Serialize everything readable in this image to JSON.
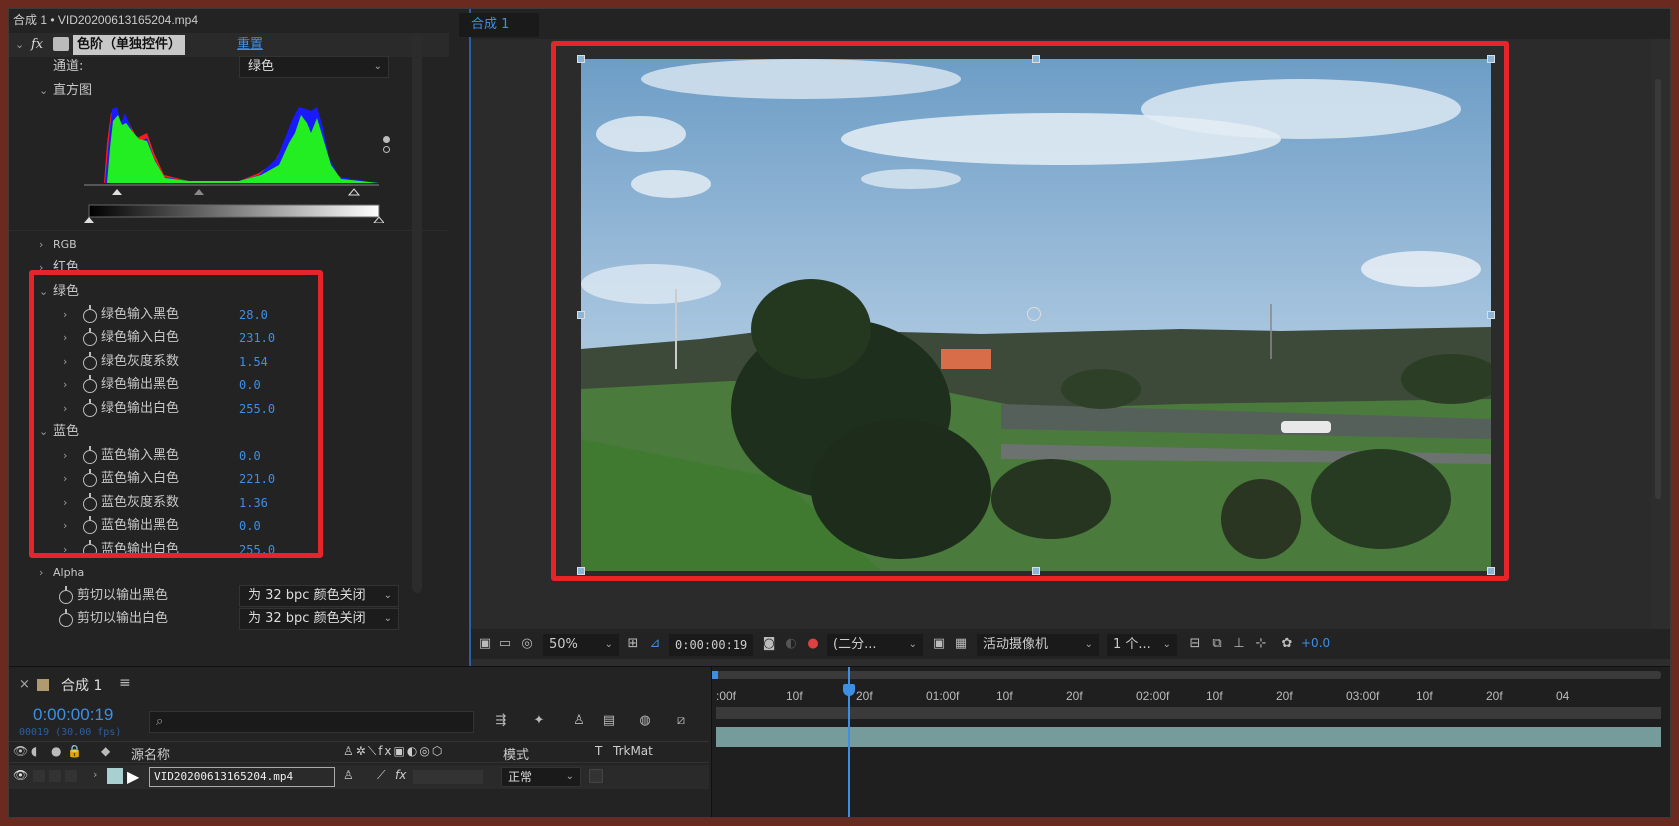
{
  "panel": {
    "title": "合成 1 • VID20200613165204.mp4",
    "effect_name": "色阶（单独控件）",
    "reset": "重置",
    "channel_label": "通道:",
    "channel_value": "绿色",
    "histogram_label": "直方图",
    "sections": {
      "rgb": "RGB",
      "red": "红色",
      "green": "绿色",
      "blue": "蓝色",
      "alpha": "Alpha"
    },
    "green_params": [
      {
        "label": "绿色输入黑色",
        "value": "28.0"
      },
      {
        "label": "绿色输入白色",
        "value": "231.0"
      },
      {
        "label": "绿色灰度系数",
        "value": "1.54"
      },
      {
        "label": "绿色输出黑色",
        "value": "0.0"
      },
      {
        "label": "绿色输出白色",
        "value": "255.0"
      }
    ],
    "blue_params": [
      {
        "label": "蓝色输入黑色",
        "value": "0.0"
      },
      {
        "label": "蓝色输入白色",
        "value": "221.0"
      },
      {
        "label": "蓝色灰度系数",
        "value": "1.36"
      },
      {
        "label": "蓝色输出黑色",
        "value": "0.0"
      },
      {
        "label": "蓝色输出白色",
        "value": "255.0"
      }
    ],
    "clip_black_label": "剪切以输出黑色",
    "clip_black_value": "为 32 bpc 颜色关闭",
    "clip_white_label": "剪切以输出白色",
    "clip_white_value": "为 32 bpc 颜色关闭"
  },
  "viewer": {
    "tab": "合成 1",
    "zoom": "50%",
    "timecode": "0:00:00:19",
    "resolution": "(二分...",
    "camera": "活动摄像机",
    "views": "1 个...",
    "exposure": "+0.0"
  },
  "timeline": {
    "tab": "合成 1",
    "menu": "≡",
    "timecode": "0:00:00:19",
    "frame_info": "00019 (30.00 fps)",
    "search_placeholder": "",
    "col_source": "源名称",
    "col_mode": "模式",
    "col_t": "T",
    "col_trkmat": "TrkMat",
    "layer_name": "VID20200613165204.mp4",
    "layer_mode": "正常",
    "ruler": [
      ":00f",
      "10f",
      "20f",
      "01:00f",
      "10f",
      "20f",
      "02:00f",
      "10f",
      "20f",
      "03:00f",
      "10f",
      "20f",
      "04"
    ],
    "playhead_frame_fraction": 0.045
  },
  "colors": {
    "accent": "#3d8fe6",
    "highlight": "#e5252a"
  }
}
